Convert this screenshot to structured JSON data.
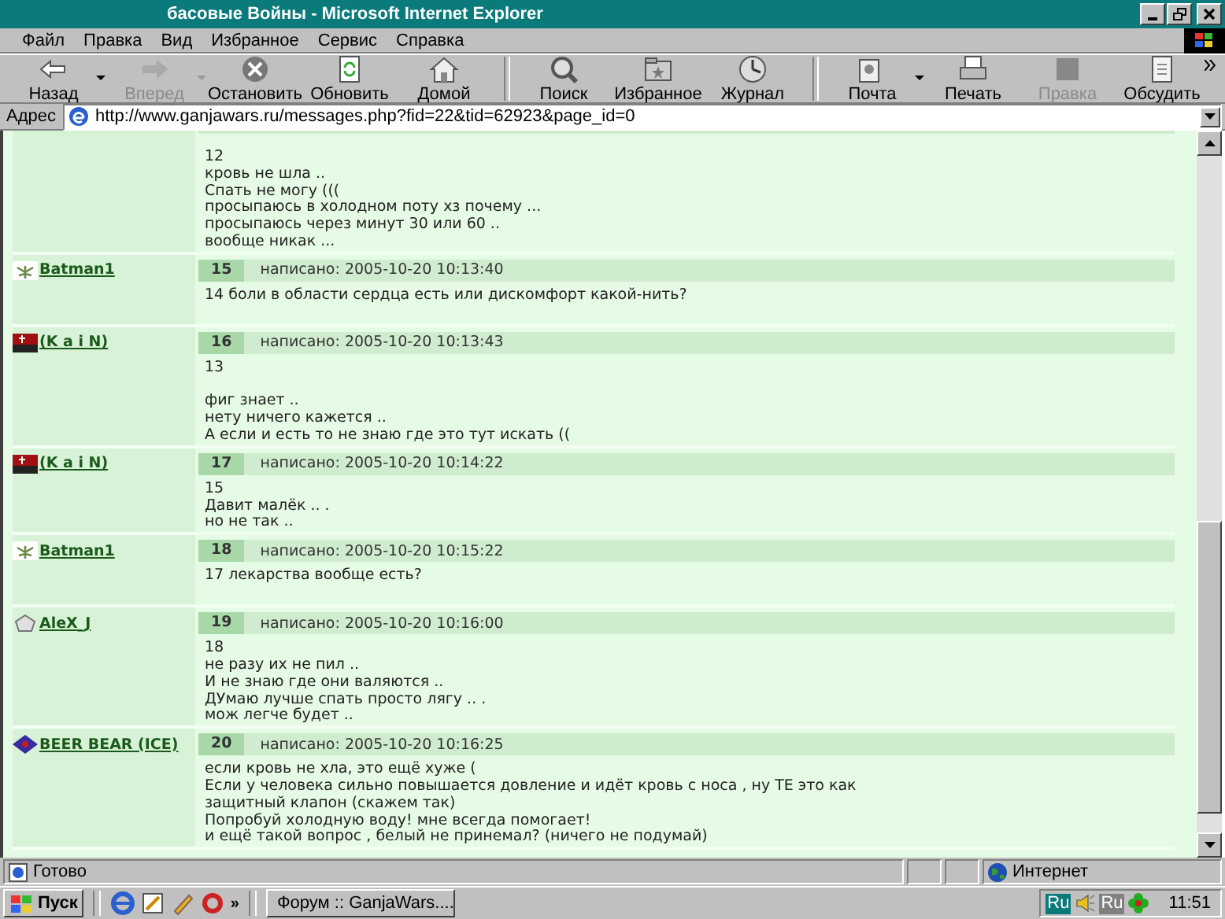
{
  "window": {
    "title": "басовые Войны - Microsoft Internet Explorer"
  },
  "menu": [
    "Файл",
    "Правка",
    "Вид",
    "Избранное",
    "Сервис",
    "Справка"
  ],
  "toolbar": [
    {
      "kind": "back",
      "label": "Назад",
      "disabled": false,
      "dropdown": true
    },
    {
      "kind": "forward",
      "label": "Вперед",
      "disabled": true,
      "dropdown": true
    },
    {
      "kind": "stop",
      "label": "Остановить",
      "disabled": false,
      "dropdown": false
    },
    {
      "kind": "refresh",
      "label": "Обновить",
      "disabled": false,
      "dropdown": false
    },
    {
      "kind": "home",
      "label": "Домой",
      "disabled": false,
      "dropdown": false
    },
    {
      "kind": "search",
      "label": "Поиск",
      "disabled": false,
      "dropdown": false
    },
    {
      "kind": "favorites",
      "label": "Избранное",
      "disabled": false,
      "dropdown": false
    },
    {
      "kind": "history",
      "label": "Журнал",
      "disabled": false,
      "dropdown": false
    },
    {
      "kind": "mail",
      "label": "Почта",
      "disabled": false,
      "dropdown": true
    },
    {
      "kind": "print",
      "label": "Печать",
      "disabled": false,
      "dropdown": false
    },
    {
      "kind": "edit",
      "label": "Правка",
      "disabled": true,
      "dropdown": false
    },
    {
      "kind": "discuss",
      "label": "Обсудить",
      "disabled": false,
      "dropdown": false
    }
  ],
  "address": {
    "label": "Адрес",
    "value": "http://www.ganjawars.ru/messages.php?fid=22&tid=62923&page_id=0"
  },
  "posts": [
    {
      "paragraphs": [
        "12\nкровь не шла ..\nСпать не могу (((\nпросыпаюсь в холодном поту хз почему ...\nпросыпаюсь через минут 30 или 60 ..\nвообще никак ..."
      ]
    },
    {
      "kind": "leaf",
      "author": "Batman1",
      "number": "15",
      "meta": "написано: 2005-10-20 10:13:40",
      "paragraphs": [
        "14 боли в области сердца есть или дискомфорт какой-нить?"
      ]
    },
    {
      "kind": "red",
      "author": "(K a i N)",
      "number": "16",
      "meta": "написано: 2005-10-20 10:13:43",
      "paragraphs": [
        "13",
        "фиг знает ..\nнету ничего кажется ..\nА если и есть то не знаю где это тут искать (("
      ]
    },
    {
      "kind": "red",
      "author": "(K a i N)",
      "number": "17",
      "meta": "написано: 2005-10-20 10:14:22",
      "paragraphs": [
        "15\nДавит малёк .. .\nно не так .."
      ]
    },
    {
      "kind": "leaf",
      "author": "Batman1",
      "number": "18",
      "meta": "написано: 2005-10-20 10:15:22",
      "paragraphs": [
        "17 лекарства вообще есть?"
      ]
    },
    {
      "kind": "badge",
      "author": "AleX_J",
      "number": "19",
      "meta": "написано: 2005-10-20 10:16:00",
      "paragraphs": [
        "18\nне разу их не пил ..\nИ не знаю где они валяются ..\nДУмаю лучше спать просто лягу .. .\nмож легче будет .."
      ]
    },
    {
      "kind": "diamond",
      "author": "BEER BEAR (ICE)",
      "number": "20",
      "meta": "написано: 2005-10-20 10:16:25",
      "paragraphs": [
        "если кровь не хла, это ещё хуже (\nЕсли у человека сильно повышается довление и идёт кровь с носа , ну TE это как\nзащитный клапон (скажем так)\nПопробуй холодную воду! мне всегда помогает!\nи ещё такой вопрос , белый не принемал? (ничего не подумай)"
      ]
    }
  ],
  "status_bar": {
    "text": "Готово",
    "zone": "Интернет"
  },
  "taskbar": {
    "start": "Пуск",
    "more": "»",
    "task": "Форум :: GanjaWars....",
    "tray": [
      "Ru",
      "Ru"
    ],
    "time": "11:51"
  }
}
